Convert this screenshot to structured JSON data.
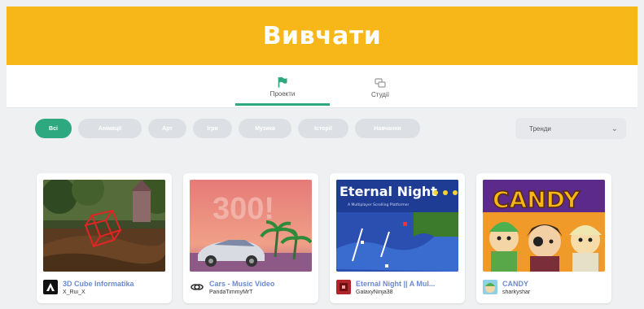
{
  "header": {
    "title": "Вивчати"
  },
  "tabs": [
    {
      "label": "Проекти",
      "icon": "flag-icon",
      "active": true
    },
    {
      "label": "Студії",
      "icon": "studio-icon",
      "active": false
    }
  ],
  "filters": {
    "items": [
      "Всі",
      "Анімації",
      "Арт",
      "Ігри",
      "Музика",
      "Історії",
      "Навчання"
    ],
    "active_color": "#2ea87e",
    "inactive_color": "#dcdfe3"
  },
  "sort": {
    "label": "Тренди"
  },
  "projects": [
    {
      "title": "3D Cube Informatika",
      "author": "X_Rui_X"
    },
    {
      "title": "Cars - Music Video",
      "author": "PandaTimmyMrT"
    },
    {
      "title": "Eternal Night || A Mul...",
      "author": "GalaxyNinja38"
    },
    {
      "title": "CANDY",
      "author": "sharkyshar"
    }
  ],
  "thumbnails": {
    "cars_number": "300!",
    "eternal_title": "Eternal Night",
    "eternal_subtitle": "A Multiplayer Scrolling Platformer",
    "candy_title": "CANDY"
  },
  "colors": {
    "brand": "#f7b718",
    "link": "#6a8ad0"
  }
}
